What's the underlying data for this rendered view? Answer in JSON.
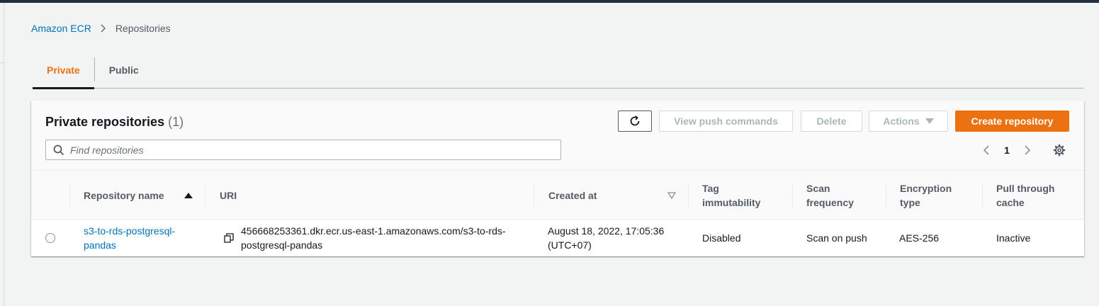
{
  "breadcrumb": {
    "root": "Amazon ECR",
    "current": "Repositories"
  },
  "tabs": [
    {
      "label": "Private"
    },
    {
      "label": "Public"
    }
  ],
  "panel": {
    "title": "Private repositories",
    "count": "(1)",
    "buttons": {
      "view_push": "View push commands",
      "delete": "Delete",
      "actions": "Actions",
      "create": "Create repository"
    },
    "search_placeholder": "Find repositories",
    "page": "1"
  },
  "table": {
    "headers": {
      "name": "Repository name",
      "uri": "URI",
      "created": "Created at",
      "tag1": "Tag",
      "tag2": "immutability",
      "scan1": "Scan",
      "scan2": "frequency",
      "enc1": "Encryption",
      "enc2": "type",
      "pull1": "Pull through",
      "pull2": "cache"
    },
    "row": {
      "name1": "s3-to-rds-postgresql-",
      "name2": "pandas",
      "uri1": "456668253361.dkr.ecr.us-east-1.amazonaws.com/s3-to-rds-",
      "uri2": "postgresql-pandas",
      "created1": "August 18, 2022, 17:05:36",
      "created2": "(UTC+07)",
      "tag": "Disabled",
      "scan": "Scan on push",
      "enc": "AES-256",
      "pull": "Inactive"
    }
  },
  "colors": {
    "accent": "#ec7211",
    "link": "#0073bb",
    "topbar": "#232f3e"
  },
  "icons": [
    "chevron-right-icon",
    "refresh-icon",
    "caret-down-icon",
    "search-icon",
    "chevron-left-icon",
    "gear-icon",
    "sort-ascending-icon",
    "sort-descending-icon",
    "copy-icon"
  ]
}
